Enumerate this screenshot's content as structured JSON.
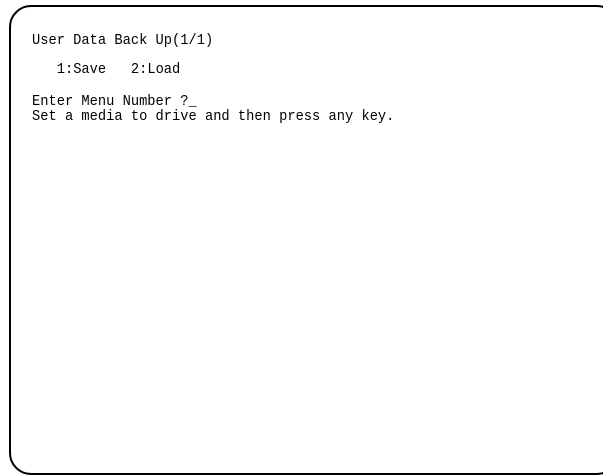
{
  "screen": {
    "title": "User Data Back Up(1/1)",
    "menu": [
      {
        "number": "1",
        "label": "Save",
        "text": "1:Save"
      },
      {
        "number": "2",
        "label": "Load",
        "text": "2:Load"
      }
    ],
    "prompt": "Enter Menu Number ?",
    "cursor": "_",
    "message": "Set a media to drive and then press any key."
  }
}
